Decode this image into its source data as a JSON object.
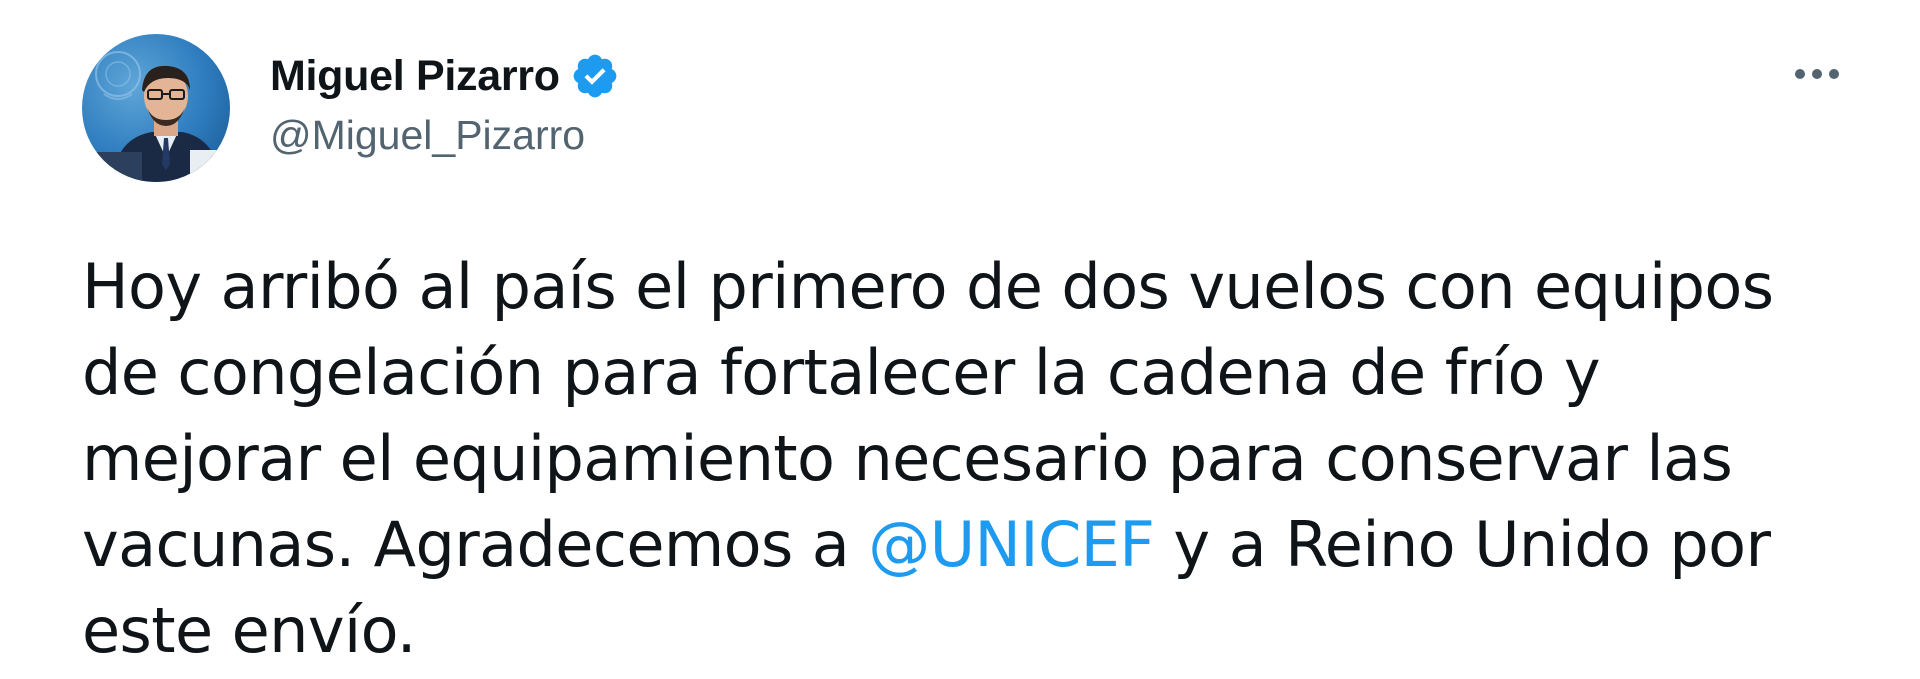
{
  "author": {
    "display_name": "Miguel Pizarro",
    "handle": "@Miguel_Pizarro",
    "verified": true,
    "avatar_icon": "profile-photo"
  },
  "menu": {
    "more_icon": "more-horizontal-icon"
  },
  "tweet": {
    "lines": [
      {
        "text": "Hoy arribó al país el primero de dos vuelos con equipos"
      },
      {
        "text": "de congelación para fortalecer la cadena de frío y"
      },
      {
        "text": "mejorar el equipamiento necesario para conservar las"
      },
      {
        "before": "vacunas. Agradecemos a ",
        "mention": "@UNICEF",
        "after": " y a Reino Unido por"
      },
      {
        "text": "este envío."
      }
    ]
  },
  "colors": {
    "text_primary": "#0f1419",
    "text_secondary": "#536471",
    "accent": "#1d9bf0",
    "background": "#ffffff"
  }
}
